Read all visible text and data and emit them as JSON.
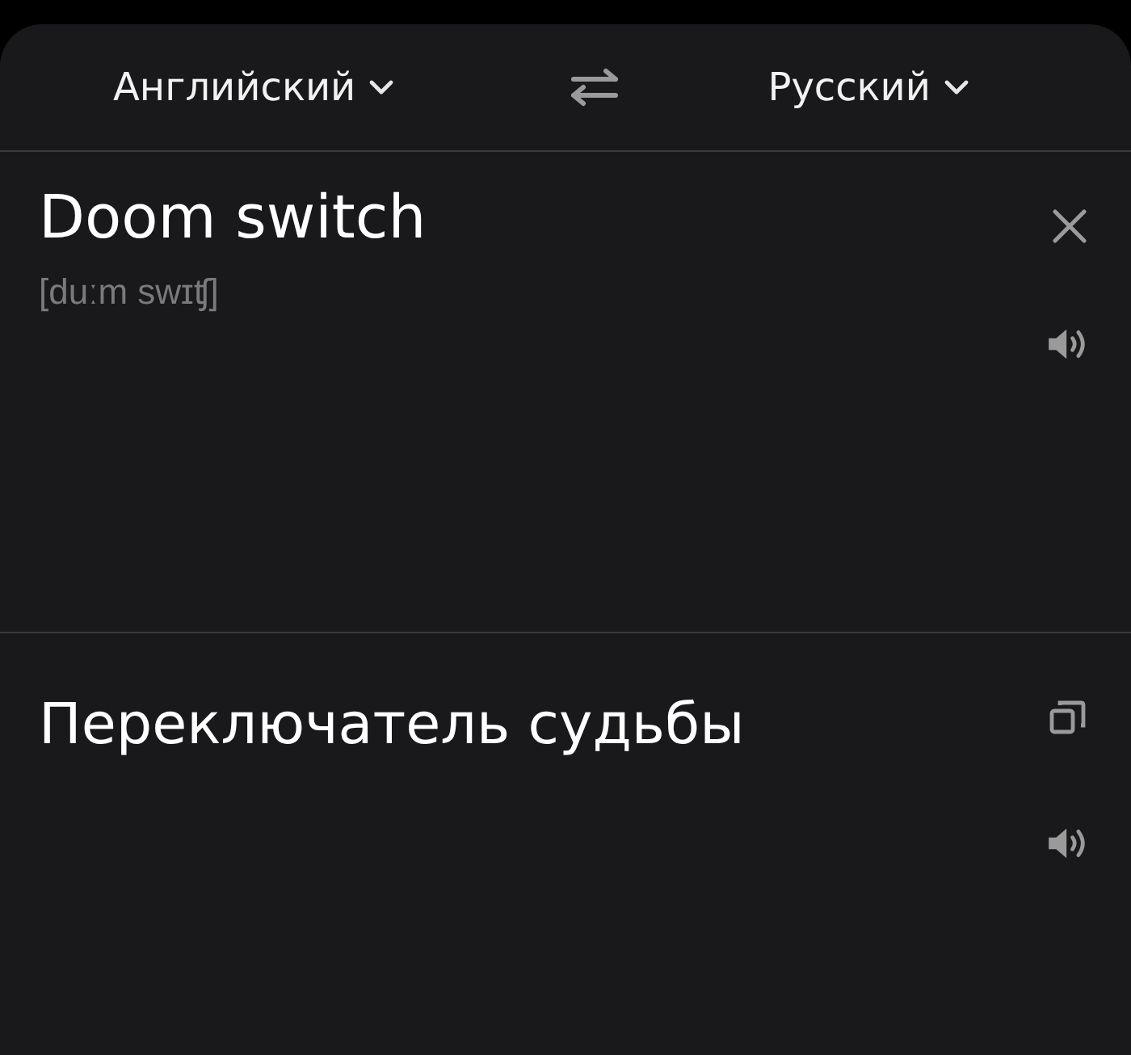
{
  "language_bar": {
    "source_language": "Английский",
    "target_language": "Русский"
  },
  "input": {
    "text": "Doom switch",
    "transcription": "[duːm swɪʧ]"
  },
  "output": {
    "text": "Переключатель судьбы"
  }
}
